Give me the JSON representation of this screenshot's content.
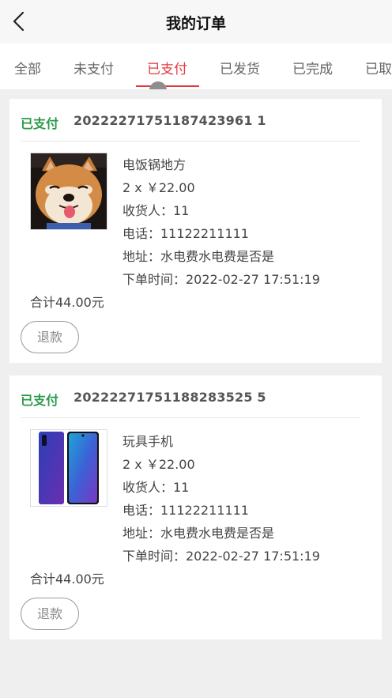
{
  "header": {
    "title": "我的订单",
    "back_icon": "chevron-left-icon"
  },
  "tabs": [
    {
      "label": "全部"
    },
    {
      "label": "未支付"
    },
    {
      "label": "已支付",
      "active": true
    },
    {
      "label": "已发货"
    },
    {
      "label": "已完成"
    },
    {
      "label": "已取"
    }
  ],
  "orders": [
    {
      "status": "已支付",
      "order_no": "20222271751187423961 1",
      "product_name": "电饭锅地方",
      "qty_price": "2 x ￥22.00",
      "receiver": "收货人：11",
      "phone": "电话：11122211111",
      "address": "地址：水电费水电费是否是",
      "order_time": "下单时间：2022-02-27 17:51:19",
      "total": "合计44.00元",
      "refund_label": "退款",
      "image": "shiba-dog-photo"
    },
    {
      "status": "已支付",
      "order_no": "20222271751188283525 5",
      "product_name": "玩具手机",
      "qty_price": "2 x ￥22.00",
      "receiver": "收货人：11",
      "phone": "电话：11122211111",
      "address": "地址：水电费水电费是否是",
      "order_time": "下单时间：2022-02-27 17:51:19",
      "total": "合计44.00元",
      "refund_label": "退款",
      "image": "smartphone-photo"
    }
  ],
  "colors": {
    "accent": "#e4393c",
    "status_green": "#2a9a4a"
  }
}
